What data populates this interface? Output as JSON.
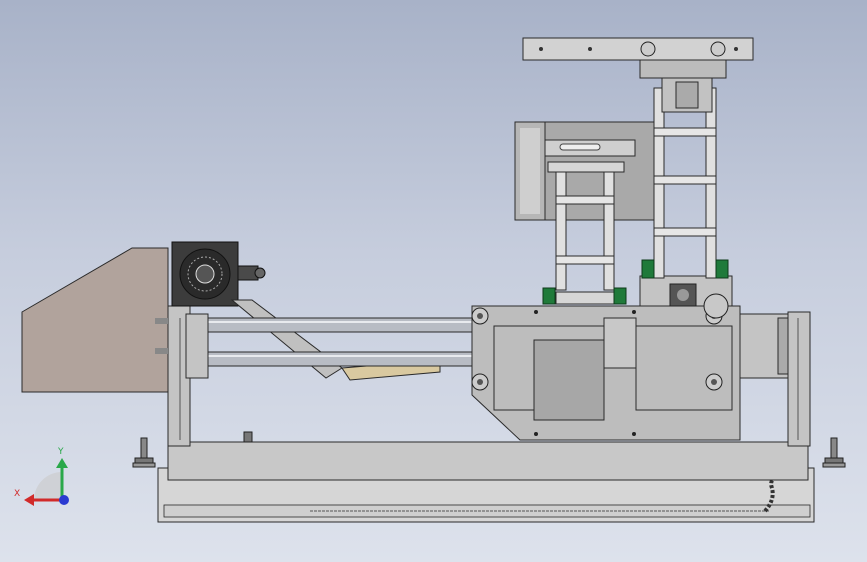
{
  "viewport": {
    "view": "front",
    "colors": {
      "background_top": "#a8b2c8",
      "background_bottom": "#dde2ec",
      "frame": "#c8c8c8",
      "outline": "#2a2a2a",
      "rod": "#b8bcc4",
      "motor": "#3c3c3c",
      "housing": "#b1a39c",
      "green_part": "#1f7a3a"
    }
  },
  "triad": {
    "x_label": "X",
    "y_label": "Y",
    "x_color": "#d12a2a",
    "y_color": "#2aa84a",
    "z_color": "#2a3ad1"
  }
}
